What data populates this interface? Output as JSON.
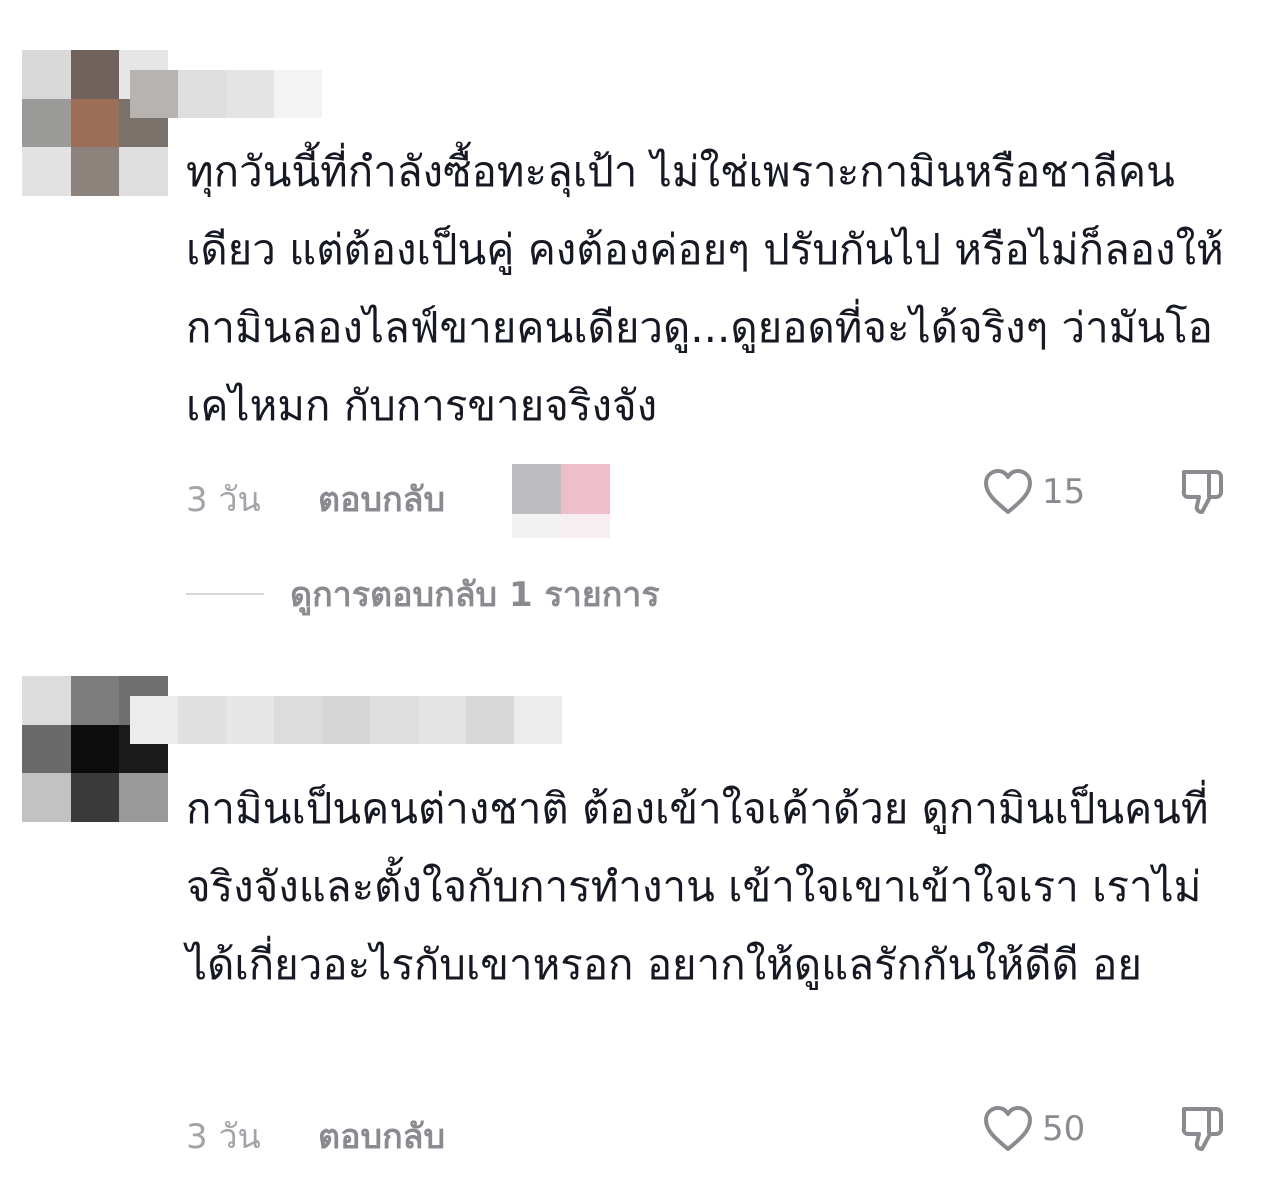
{
  "comments": [
    {
      "text": "ทุกวันนี้ที่กำลังซื้อทะลุเป้า ไม่ใช่เพราะกามินหรือชาลีคนเดียว แต่ต้องเป็นคู่ คงต้องค่อยๆ ปรับกันไป หรือไม่ก็ลองให้กามินลองไลฟ์ขายคนเดียวดู...ดูยอดที่จะได้จริงๆ ว่ามันโอเคไหมก กับการขายจริงจัง",
      "timestamp": "3 วัน",
      "reply_label": "ตอบกลับ",
      "like_count": "15",
      "view_replies_label": "ดูการตอบกลับ 1 รายการ",
      "avatar_icon": "pixelated-avatar",
      "username_icon": "pixelated-username",
      "avatar_colors": [
        "#d9d9d9",
        "#6f625a",
        "#e6e6e6",
        "#9a9a98",
        "#9c6e58",
        "#7a716a",
        "#e2e2e2",
        "#8c837d",
        "#dedede"
      ],
      "username_colors": [
        "#b6b3b1",
        "#dedede",
        "#e4e4e4",
        "#f4f4f4"
      ]
    },
    {
      "text": "กามินเป็นคนต่างชาติ ต้องเข้าใจเค้าด้วย ดูกามินเป็นคนที่จริงจังและตั้งใจกับการทำงาน เข้าใจเขาเข้าใจเรา เราไม่ได้เกี่ยวอะไรกับเขาหรอก อยากให้ดูแลรักกันให้ดีดี อย",
      "timestamp": "3 วัน",
      "reply_label": "ตอบกลับ",
      "like_count": "50",
      "avatar_icon": "pixelated-avatar",
      "username_icon": "pixelated-username",
      "avatar_colors": [
        "#dcdcdc",
        "#7c7c7c",
        "#6f6f6f",
        "#6a6a6a",
        "#0c0c0c",
        "#1a1a1a",
        "#c2c2c2",
        "#3a3a3a",
        "#9a9a9a"
      ],
      "username_colors": [
        "#ececec",
        "#e0e0e0",
        "#e6e6e6",
        "#dcdcdc",
        "#d6d6d6",
        "#dedede",
        "#e4e4e4",
        "#d8d8d8",
        "#ececec"
      ]
    }
  ],
  "reaction_thumb_colors": [
    "#bdbcc0",
    "#ecbfcb",
    "#f2f2f2",
    "#f6eef0"
  ],
  "icons": {
    "like": "heart-outline-icon",
    "dislike": "thumbs-down-icon"
  },
  "colors": {
    "text_primary": "#161823",
    "text_secondary": "#8a8b91",
    "timestamp": "#a3a3a9",
    "divider": "#d6d6d8",
    "background": "#ffffff"
  }
}
